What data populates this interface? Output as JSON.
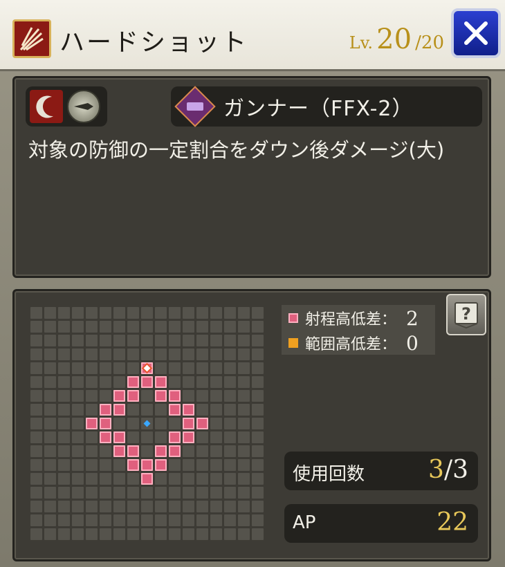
{
  "header": {
    "title": "ハードショット",
    "level_label": "Lv.",
    "level_current": "20",
    "level_max": "/20",
    "skill_icon": "slash-burst-icon",
    "close_icon": "close-x-icon"
  },
  "info": {
    "ability_icons": [
      "crescent-slash-icon",
      "bullet-emblem-icon"
    ],
    "job_icon": "gunner-job-icon",
    "job_name": "ガンナー（FFX-2）",
    "description": "対象の防御の一定割合をダウン後ダメージ(大)"
  },
  "range": {
    "grid_size": 17,
    "range_cells": [
      [
        4,
        8
      ],
      [
        5,
        7
      ],
      [
        5,
        8
      ],
      [
        5,
        9
      ],
      [
        6,
        6
      ],
      [
        6,
        7
      ],
      [
        6,
        9
      ],
      [
        6,
        10
      ],
      [
        7,
        5
      ],
      [
        7,
        6
      ],
      [
        7,
        10
      ],
      [
        7,
        11
      ],
      [
        8,
        4
      ],
      [
        8,
        5
      ],
      [
        8,
        11
      ],
      [
        8,
        12
      ],
      [
        9,
        5
      ],
      [
        9,
        6
      ],
      [
        9,
        10
      ],
      [
        9,
        11
      ],
      [
        10,
        6
      ],
      [
        10,
        7
      ],
      [
        10,
        9
      ],
      [
        10,
        10
      ],
      [
        11,
        7
      ],
      [
        11,
        8
      ],
      [
        11,
        9
      ],
      [
        12,
        8
      ]
    ],
    "target_cell": [
      4,
      8
    ],
    "center_cell": [
      8,
      8
    ],
    "colors": {
      "range": "#e0607e",
      "area": "#f0a020",
      "center": "#3aa8ff",
      "target": "#e8502a"
    },
    "legend": {
      "range_label": "射程高低差：",
      "range_value": "2",
      "area_label": "範囲高低差：",
      "area_value": "0"
    },
    "help_icon": "help-book-icon"
  },
  "stats": {
    "uses_label": "使用回数",
    "uses_current": "3",
    "uses_max": "/3",
    "ap_label": "AP",
    "ap_value": "22"
  }
}
